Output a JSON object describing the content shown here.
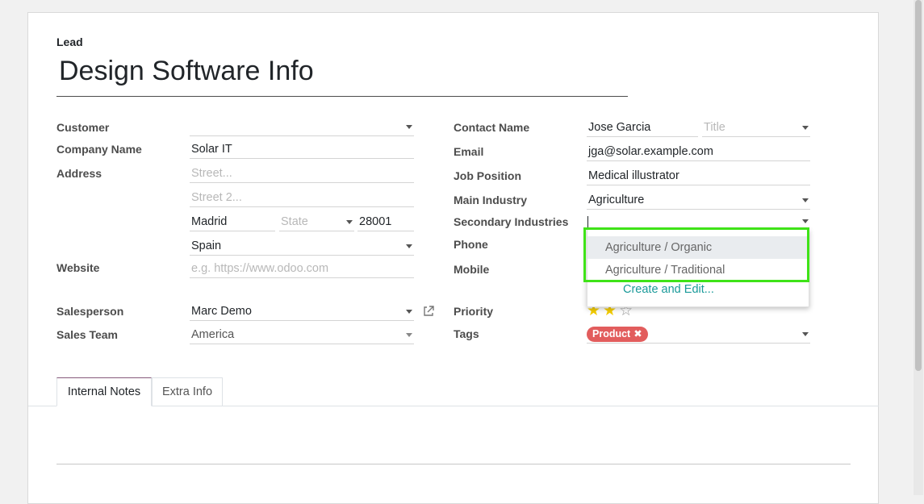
{
  "form": {
    "record_type": "Lead",
    "title": "Design Software Info"
  },
  "left": {
    "customer_label": "Customer",
    "customer_value": "",
    "company_label": "Company Name",
    "company_value": "Solar IT",
    "address_label": "Address",
    "street_placeholder": "Street...",
    "street2_placeholder": "Street 2...",
    "city_value": "Madrid",
    "state_placeholder": "State",
    "zip_value": "28001",
    "country_value": "Spain",
    "website_label": "Website",
    "website_placeholder": "e.g. https://www.odoo.com",
    "salesperson_label": "Salesperson",
    "salesperson_value": "Marc Demo",
    "team_label": "Sales Team",
    "team_value": "America"
  },
  "right": {
    "contact_label": "Contact Name",
    "contact_value": "Jose Garcia",
    "title_placeholder": "Title",
    "email_label": "Email",
    "email_value": "jga@solar.example.com",
    "job_label": "Job Position",
    "job_value": "Medical illustrator",
    "main_industry_label": "Main Industry",
    "main_industry_value": "Agriculture",
    "secondary_label": "Secondary Industries",
    "phone_label": "Phone",
    "mobile_label": "Mobile",
    "priority_label": "Priority",
    "priority_value": 2,
    "priority_max": 3,
    "tags_label": "Tags",
    "tag_value": "Product"
  },
  "dropdown": {
    "options": [
      "Agriculture / Organic",
      "Agriculture / Traditional"
    ],
    "create_label": "Create and Edit..."
  },
  "tabs": [
    "Internal Notes",
    "Extra Info"
  ],
  "colors": {
    "highlight": "#3fe318",
    "tag": "#e25d5d",
    "star": "#f3cc00",
    "link": "#1a9a9a"
  }
}
